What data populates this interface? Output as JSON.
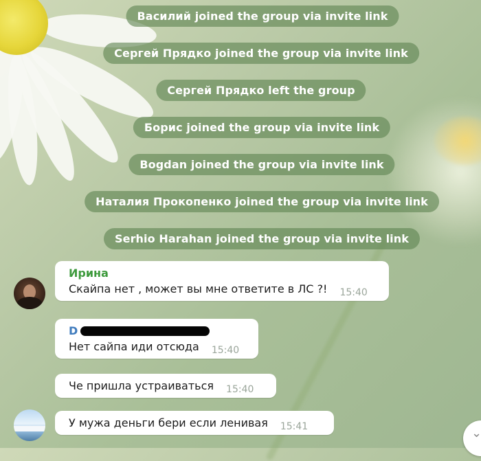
{
  "service_messages": [
    "Василий joined the group via invite link",
    "Сергей Прядко joined the group via invite link",
    "Сергей Прядко left the group",
    "Борис joined the group via invite link",
    "Bogdan joined the group via invite link",
    "Наталия Прокопенко joined the group via invite link",
    "Serhio Harahan joined the group via invite link"
  ],
  "messages": [
    {
      "sender": "Ирина",
      "text": "Скайпа нет , может вы мне ответите в ЛС ?!",
      "time": "15:40"
    },
    {
      "sender": "D",
      "text": "Нет сайпа иди отсюда",
      "time": "15:40"
    },
    {
      "text": "Че пришла устраиваться",
      "time": "15:40"
    },
    {
      "text": "У мужа деньги бери если ленивая",
      "time": "15:41"
    }
  ],
  "icons": {
    "scroll_down": "chevron-down-icon"
  }
}
